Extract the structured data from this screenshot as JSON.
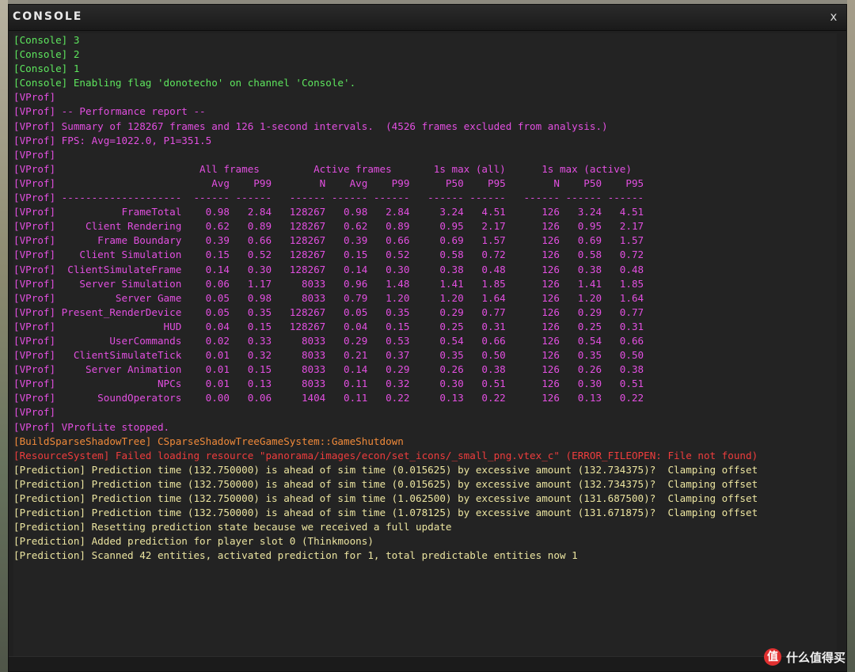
{
  "window": {
    "title": "CONSOLE",
    "close_symbol": "x"
  },
  "colors": {
    "Console": "#5ee65e",
    "VProf": "#e24fe0",
    "BuildSparseShadowTree": "#f08a3a",
    "ResourceSystem": "#ef3d3d",
    "Prediction": "#ece5a0"
  },
  "lines": [
    {
      "ch": "Console",
      "text": "[Console] 3"
    },
    {
      "ch": "Console",
      "text": "[Console] 2"
    },
    {
      "ch": "Console",
      "text": "[Console] 1"
    },
    {
      "ch": "Console",
      "text": "[Console] Enabling flag 'donotecho' on channel 'Console'."
    },
    {
      "ch": "VProf",
      "text": "[VProf]"
    },
    {
      "ch": "VProf",
      "text": "[VProf] -- Performance report --"
    },
    {
      "ch": "VProf",
      "text": "[VProf] Summary of 128267 frames and 126 1-second intervals.  (4526 frames excluded from analysis.)"
    },
    {
      "ch": "VProf",
      "text": "[VProf] FPS: Avg=1022.0, P1=351.5"
    },
    {
      "ch": "VProf",
      "text": "[VProf]"
    },
    {
      "ch": "VProf",
      "text": "[VProf]                        All frames         Active frames       1s max (all)      1s max (active)"
    },
    {
      "ch": "VProf",
      "text": "[VProf]                          Avg    P99        N    Avg    P99      P50    P95        N    P50    P95"
    },
    {
      "ch": "VProf",
      "text": "[VProf] --------------------  ------ ------   ------ ------ ------   ------ ------   ------ ------ ------"
    },
    {
      "ch": "VProf",
      "text": "[VProf]           FrameTotal    0.98   2.84   128267   0.98   2.84     3.24   4.51      126   3.24   4.51"
    },
    {
      "ch": "VProf",
      "text": "[VProf]     Client Rendering    0.62   0.89   128267   0.62   0.89     0.95   2.17      126   0.95   2.17"
    },
    {
      "ch": "VProf",
      "text": "[VProf]       Frame Boundary    0.39   0.66   128267   0.39   0.66     0.69   1.57      126   0.69   1.57"
    },
    {
      "ch": "VProf",
      "text": "[VProf]    Client Simulation    0.15   0.52   128267   0.15   0.52     0.58   0.72      126   0.58   0.72"
    },
    {
      "ch": "VProf",
      "text": "[VProf]  ClientSimulateFrame    0.14   0.30   128267   0.14   0.30     0.38   0.48      126   0.38   0.48"
    },
    {
      "ch": "VProf",
      "text": "[VProf]    Server Simulation    0.06   1.17     8033   0.96   1.48     1.41   1.85      126   1.41   1.85"
    },
    {
      "ch": "VProf",
      "text": "[VProf]          Server Game    0.05   0.98     8033   0.79   1.20     1.20   1.64      126   1.20   1.64"
    },
    {
      "ch": "VProf",
      "text": "[VProf] Present_RenderDevice    0.05   0.35   128267   0.05   0.35     0.29   0.77      126   0.29   0.77"
    },
    {
      "ch": "VProf",
      "text": "[VProf]                  HUD    0.04   0.15   128267   0.04   0.15     0.25   0.31      126   0.25   0.31"
    },
    {
      "ch": "VProf",
      "text": "[VProf]         UserCommands    0.02   0.33     8033   0.29   0.53     0.54   0.66      126   0.54   0.66"
    },
    {
      "ch": "VProf",
      "text": "[VProf]   ClientSimulateTick    0.01   0.32     8033   0.21   0.37     0.35   0.50      126   0.35   0.50"
    },
    {
      "ch": "VProf",
      "text": "[VProf]     Server Animation    0.01   0.15     8033   0.14   0.29     0.26   0.38      126   0.26   0.38"
    },
    {
      "ch": "VProf",
      "text": "[VProf]                 NPCs    0.01   0.13     8033   0.11   0.32     0.30   0.51      126   0.30   0.51"
    },
    {
      "ch": "VProf",
      "text": "[VProf]       SoundOperators    0.00   0.06     1404   0.11   0.22     0.13   0.22      126   0.13   0.22"
    },
    {
      "ch": "VProf",
      "text": "[VProf]"
    },
    {
      "ch": "VProf",
      "text": "[VProf] VProfLite stopped."
    },
    {
      "ch": "BuildSparseShadowTree",
      "text": "[BuildSparseShadowTree] CSparseShadowTreeGameSystem::GameShutdown"
    },
    {
      "ch": "ResourceSystem",
      "text": "[ResourceSystem] Failed loading resource \"panorama/images/econ/set_icons/_small_png.vtex_c\" (ERROR_FILEOPEN: File not found)"
    },
    {
      "ch": "Prediction",
      "text": "[Prediction] Prediction time (132.750000) is ahead of sim time (0.015625) by excessive amount (132.734375)?  Clamping offset"
    },
    {
      "ch": "Prediction",
      "text": "[Prediction] Prediction time (132.750000) is ahead of sim time (0.015625) by excessive amount (132.734375)?  Clamping offset"
    },
    {
      "ch": "Prediction",
      "text": "[Prediction] Prediction time (132.750000) is ahead of sim time (1.062500) by excessive amount (131.687500)?  Clamping offset"
    },
    {
      "ch": "Prediction",
      "text": "[Prediction] Prediction time (132.750000) is ahead of sim time (1.078125) by excessive amount (131.671875)?  Clamping offset"
    },
    {
      "ch": "Prediction",
      "text": "[Prediction] Resetting prediction state because we received a full update"
    },
    {
      "ch": "Prediction",
      "text": "[Prediction] Added prediction for player slot 0 (Thinkmoons)"
    },
    {
      "ch": "Prediction",
      "text": "[Prediction] Scanned 42 entities, activated prediction for 1, total predictable entities now 1"
    }
  ],
  "watermark": {
    "badge": "值",
    "text": "什么值得买"
  }
}
